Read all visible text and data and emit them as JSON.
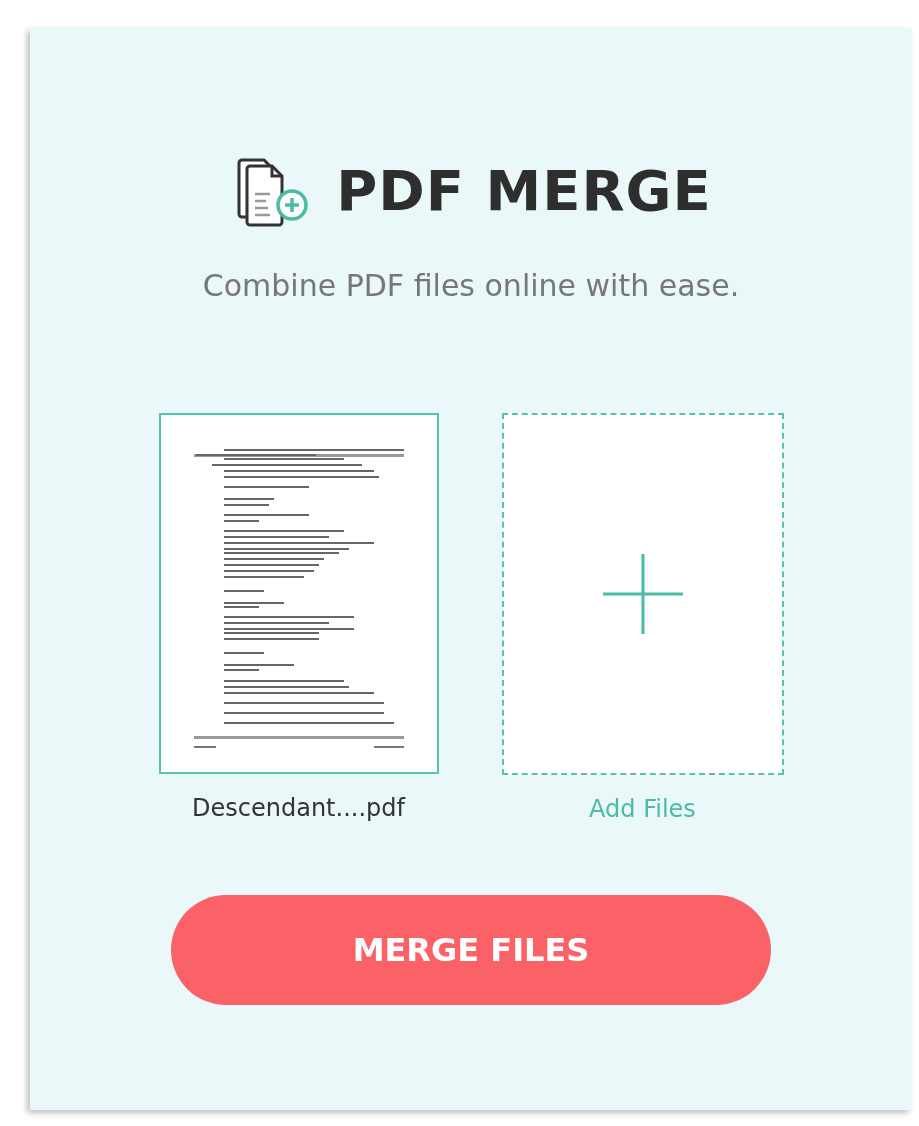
{
  "header": {
    "title": "PDF MERGE",
    "subtitle": "Combine PDF files online with ease."
  },
  "files": [
    {
      "kind": "file",
      "name": "Descendant....pdf"
    },
    {
      "kind": "add",
      "name": "Add Files"
    }
  ],
  "merge_button": {
    "label": "MERGE FILES"
  }
}
